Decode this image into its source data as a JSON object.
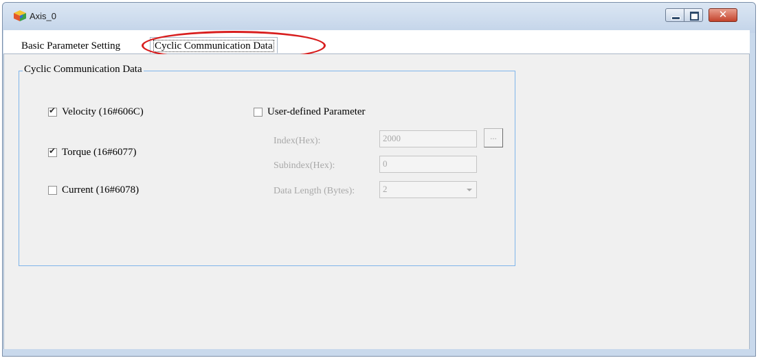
{
  "window": {
    "title": "Axis_0",
    "icon": "cube-icon",
    "controls": {
      "minimize": "minimize-icon",
      "maximize": "maximize-icon",
      "close": "close-icon",
      "close_glyph": "✕"
    }
  },
  "tabs": [
    {
      "label": "Basic Parameter Setting",
      "active": false
    },
    {
      "label": "Cyclic Communication Data",
      "active": true
    }
  ],
  "group": {
    "title": "Cyclic Communication Data",
    "checkboxes": [
      {
        "label": "Velocity (16#606C)",
        "checked": true
      },
      {
        "label": "Torque (16#6077)",
        "checked": true
      },
      {
        "label": "Current (16#6078)",
        "checked": false
      }
    ],
    "user_defined": {
      "label": "User-defined Parameter",
      "checked": false,
      "index_label": "Index(Hex):",
      "index_value": "2000",
      "browse_label": "...",
      "subindex_label": "Subindex(Hex):",
      "subindex_value": "0",
      "length_label": "Data Length (Bytes):",
      "length_value": "2"
    }
  },
  "colors": {
    "highlight": "#d81e1e",
    "frame": "#c9d9ec",
    "group_border": "#7eb4ea"
  }
}
